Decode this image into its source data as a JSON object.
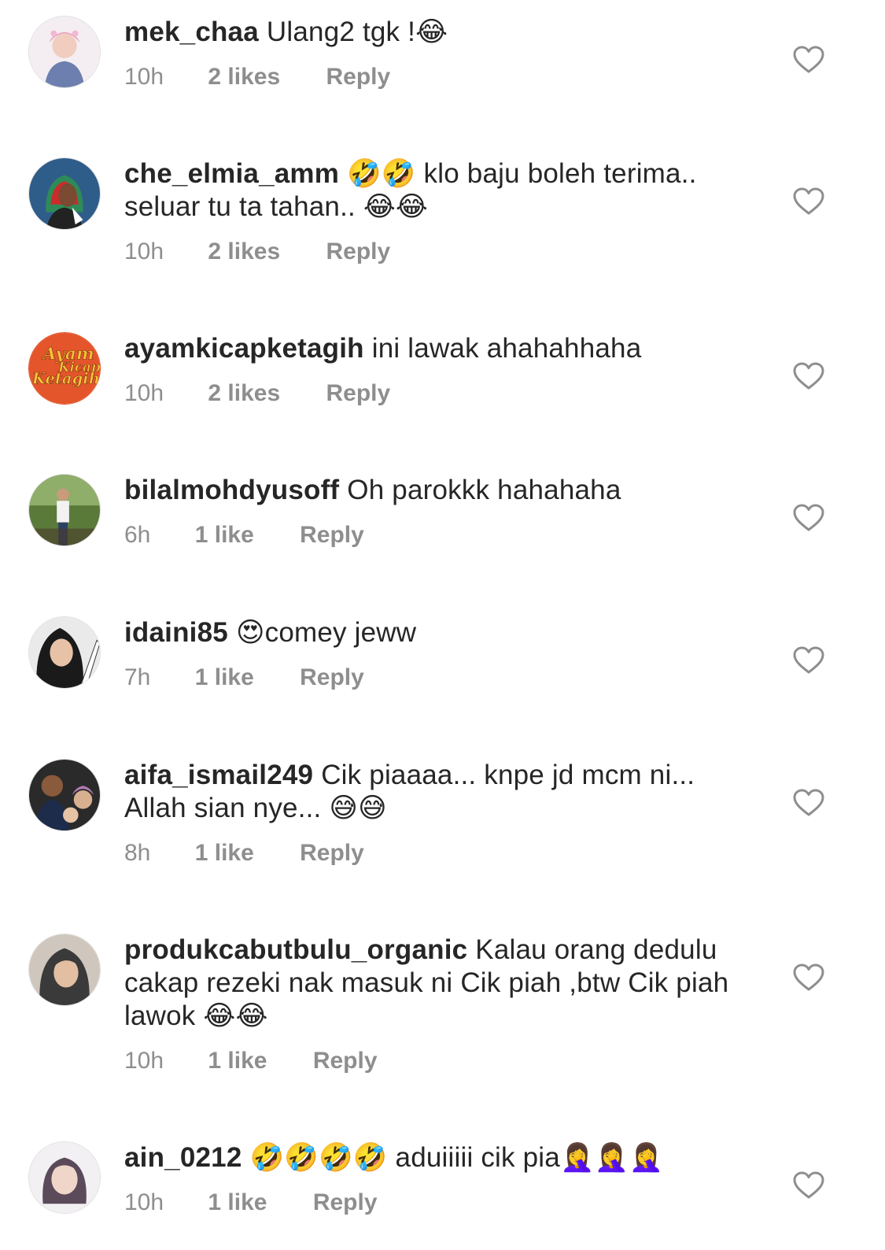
{
  "comments": [
    {
      "username": "mek_chaa",
      "text": "Ulang2 tgk !😂",
      "time": "10h",
      "likes": "2 likes",
      "reply": "Reply",
      "avatar_icon": "avatar-photo-icon"
    },
    {
      "username": "che_elmia_amm",
      "text": "🤣🤣 klo baju boleh terima.. seluar tu ta tahan.. 😂😂",
      "time": "10h",
      "likes": "2 likes",
      "reply": "Reply",
      "avatar_icon": "avatar-illustration-icon"
    },
    {
      "username": "ayamkicapketagih",
      "text": "ini lawak ahahahhaha",
      "time": "10h",
      "likes": "2 likes",
      "reply": "Reply",
      "avatar_icon": "avatar-logo-icon",
      "avatar_logo_text": [
        "Ayam",
        "Kicap",
        "Ketagih"
      ]
    },
    {
      "username": "bilalmohdyusoff",
      "text": "Oh parokkk hahahaha",
      "time": "6h",
      "likes": "1 like",
      "reply": "Reply",
      "avatar_icon": "avatar-photo-icon"
    },
    {
      "username": "idaini85",
      "text": "😍comey jeww",
      "time": "7h",
      "likes": "1 like",
      "reply": "Reply",
      "avatar_icon": "avatar-photo-icon"
    },
    {
      "username": "aifa_ismail249",
      "text": "Cik piaaaa... knpe jd mcm ni... Allah sian nye... 😅😅",
      "time": "8h",
      "likes": "1 like",
      "reply": "Reply",
      "avatar_icon": "avatar-photo-icon"
    },
    {
      "username": "produkcabutbulu_organic",
      "text": "Kalau orang dedulu cakap rezeki nak masuk ni Cik piah ,btw Cik piah lawok 😂😂",
      "time": "10h",
      "likes": "1 like",
      "reply": "Reply",
      "avatar_icon": "avatar-photo-icon"
    },
    {
      "username": "ain_0212",
      "text": "🤣🤣🤣🤣 aduiiiii cik pia🤦‍♀️🤦‍♀️🤦‍♀️",
      "time": "10h",
      "likes": "1 like",
      "reply": "Reply",
      "avatar_icon": "avatar-photo-icon"
    }
  ],
  "colors": {
    "text": "#262626",
    "meta": "#8e8e8e",
    "heart_stroke": "#8e8e8e",
    "logo_bg": "#e4552b",
    "logo_text": "#f6c43a"
  },
  "icons": {
    "like": "heart-outline-icon"
  }
}
